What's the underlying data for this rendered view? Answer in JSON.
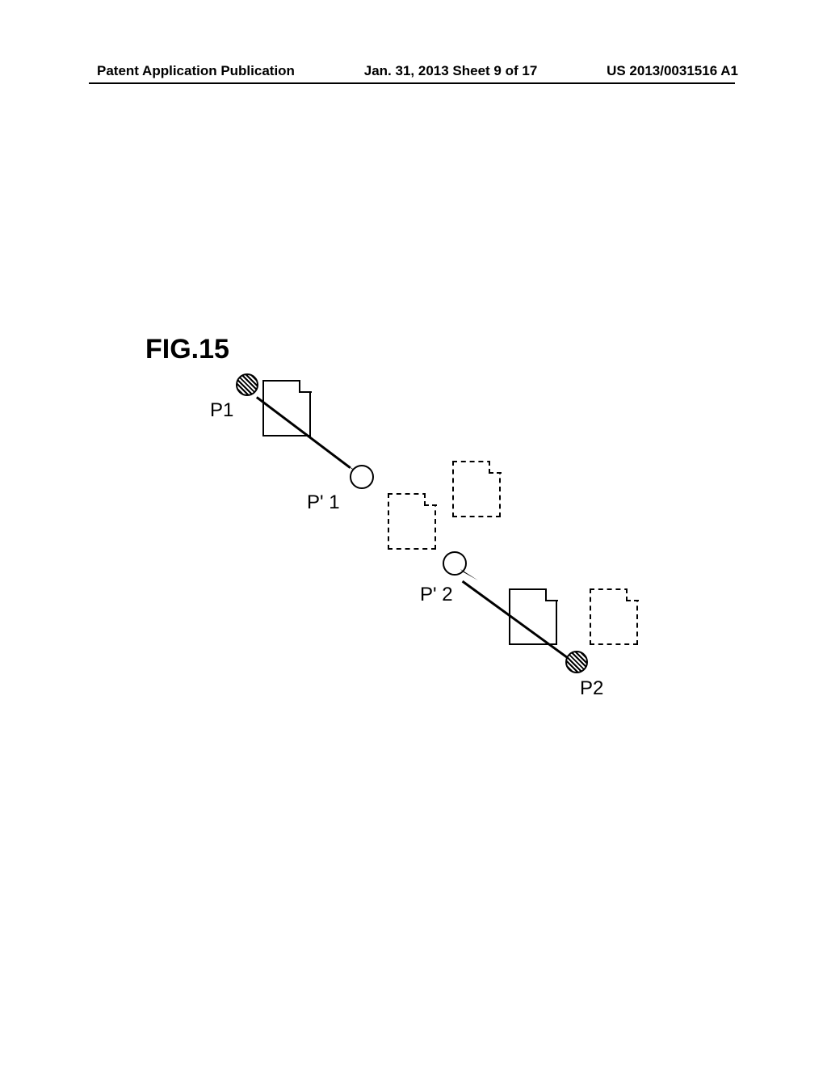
{
  "header": {
    "left": "Patent Application Publication",
    "center": "Jan. 31, 2013  Sheet 9 of 17",
    "right": "US 2013/0031516 A1"
  },
  "figure": {
    "label": "FIG.15"
  },
  "labels": {
    "p1": "P1",
    "p1prime": "P' 1",
    "p2prime": "P' 2",
    "p2": "P2"
  }
}
